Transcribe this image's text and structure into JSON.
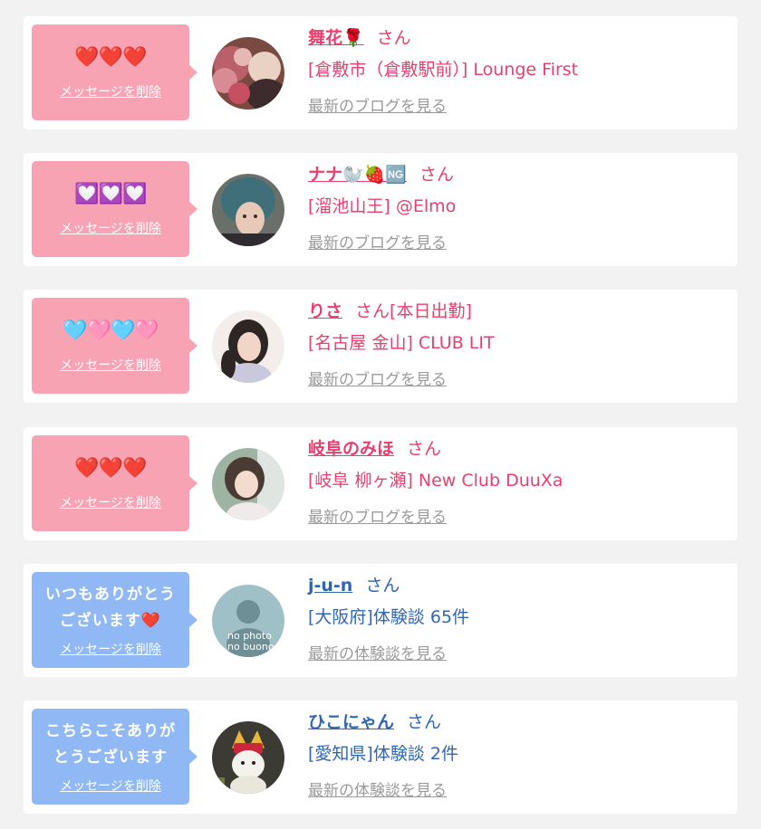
{
  "colors": {
    "pink_accent": "#e8406e",
    "blue_accent": "#2f66b3",
    "pink_bubble": "#f7a3b4",
    "blue_bubble": "#8fb8f4",
    "muted_link": "#9a9a9a"
  },
  "cards": [
    {
      "bubble_message": "❤️❤️❤️",
      "delete_label": "メッセージを削除",
      "name": "舞花🌹",
      "honorific": "さん",
      "status": "",
      "detail": "[倉敷市（倉敷駅前）] Lounge First",
      "link_label": "最新のブログを見る"
    },
    {
      "bubble_message": "💟💟💟",
      "delete_label": "メッセージを削除",
      "name": "ナナ🦭🍓🆖",
      "honorific": "さん",
      "status": "",
      "detail": "[溜池山王] @Elmo",
      "link_label": "最新のブログを見る"
    },
    {
      "bubble_message": "🩵🩷🩵🩷",
      "delete_label": "メッセージを削除",
      "name": "りさ",
      "honorific": "さん",
      "status": "[本日出勤]",
      "detail": "[名古屋 金山] CLUB LIT",
      "link_label": "最新のブログを見る"
    },
    {
      "bubble_message": "❤️❤️❤️",
      "delete_label": "メッセージを削除",
      "name": "岐阜のみほ",
      "honorific": "さん",
      "status": "",
      "detail": "[岐阜 柳ヶ瀬] New Club DuuXa",
      "link_label": "最新のブログを見る"
    },
    {
      "bubble_message": "いつもありがとうございます❤️",
      "delete_label": "メッセージを削除",
      "name": "j-u-n",
      "honorific": "さん",
      "status": "",
      "detail": "[大阪府]体験談 65件",
      "link_label": "最新の体験談を見る",
      "avatar_text": [
        "no photo",
        "no buono"
      ]
    },
    {
      "bubble_message": "こちらこそありがとうございます",
      "delete_label": "メッセージを削除",
      "name": "ひこにゃん",
      "honorific": "さん",
      "status": "",
      "detail": "[愛知県]体験談 2件",
      "link_label": "最新の体験談を見る"
    }
  ]
}
